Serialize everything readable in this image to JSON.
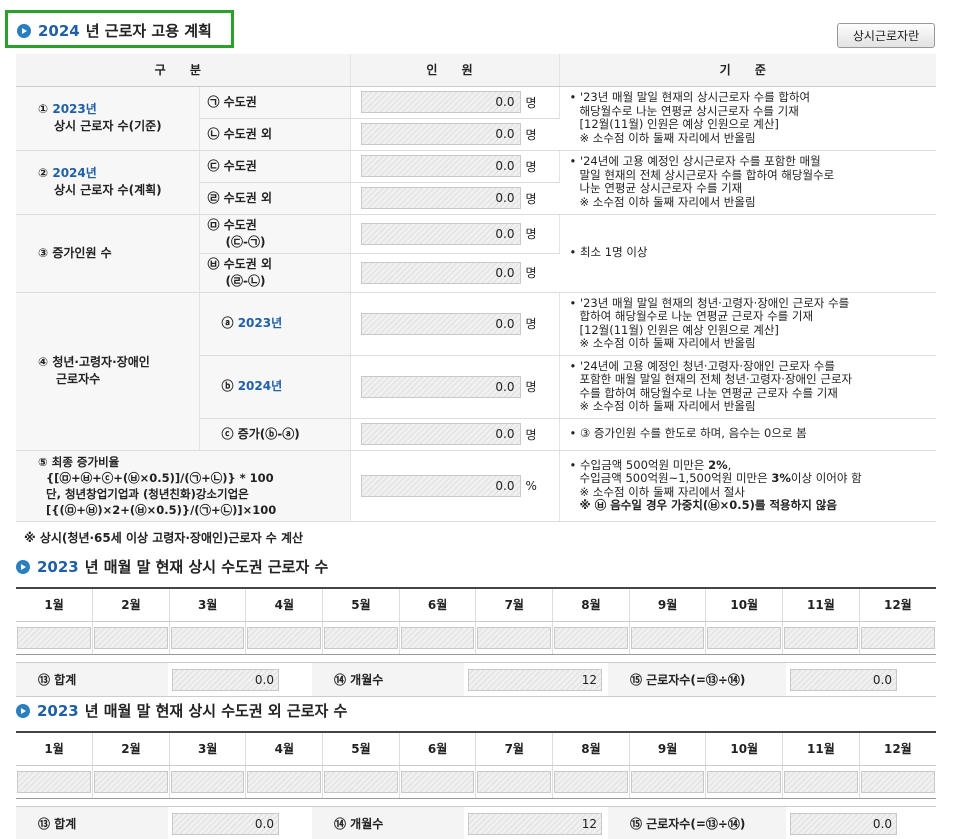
{
  "header": {
    "year": "2024",
    "title_rest": "년 근로자 고용 계획",
    "button": "상시근로자란"
  },
  "table": {
    "headers": [
      "구  분",
      "인  원",
      "기  준"
    ],
    "unit_person": "명",
    "unit_percent": "%",
    "rows": {
      "r1": {
        "cat_num": "①",
        "cat_year": "2023년",
        "cat_text": "상시 근로자 수(기준)",
        "subs": [
          {
            "label": "㉠ 수도권",
            "value": "0.0"
          },
          {
            "label": "㉡ 수도권 외",
            "value": "0.0"
          }
        ],
        "criteria": [
          "• '23년 매월 말일 현재의 상시근로자 수를 합하여",
          "해당월수로 나눈 연평균 상시근로자 수를 기재",
          "[12월(11월) 인원은 예상 인원으로 계산]",
          "※ 소수점 이하 둘째 자리에서 반올림"
        ]
      },
      "r2": {
        "cat_num": "②",
        "cat_year": "2024년",
        "cat_text": "상시 근로자 수(계획)",
        "subs": [
          {
            "label": "㉢ 수도권",
            "value": "0.0"
          },
          {
            "label": "㉣ 수도권 외",
            "value": "0.0"
          }
        ],
        "criteria": [
          "• '24년에 고용 예정인 상시근로자 수를 포함한 매월",
          "말일 현재의 전체 상시근로자 수를 합하여 해당월수로",
          "나눈 연평균 상시근로자 수를 기재",
          "※ 소수점 이하 둘째 자리에서 반올림"
        ]
      },
      "r3": {
        "cat_text": "③ 증가인원 수",
        "subs": [
          {
            "label": "㉤ 수도권",
            "label2": "(㉢-㉠)",
            "value": "0.0"
          },
          {
            "label": "㉥ 수도권 외",
            "label2": "(㉣-㉡)",
            "value": "0.0"
          }
        ],
        "criteria": "• 최소 1명 이상"
      },
      "r4": {
        "cat_line1": "④ 청년·고령자·장애인",
        "cat_line2": "근로자수",
        "subs": [
          {
            "label_prefix": "ⓐ",
            "label_year": "2023년",
            "value": "0.0",
            "criteria": [
              "• '23년 매월 말일 현재의 청년·고령자·장애인 근로자 수를",
              "합하여 해당월수로 나눈 연평균 근로자 수를 기재",
              "[12월(11월) 인원은 예상 인원으로 계산]",
              "※ 소수점 이하 둘째 자리에서 반올림"
            ]
          },
          {
            "label_prefix": "ⓑ",
            "label_year": "2024년",
            "value": "0.0",
            "criteria": [
              "• '24년에 고용 예정인 청년·고령자·장애인 근로자 수를",
              "포함한 매월 말일 현재의 전체 청년·고령자·장애인 근로자",
              "수를 합하여 해당월수로 나눈 연평균 근로자 수를 기재",
              "※ 소수점 이하 둘째 자리에서 반올림"
            ]
          },
          {
            "label": "ⓒ 증가(ⓑ-ⓐ)",
            "value": "0.0",
            "criteria": [
              "• ③ 증가인원 수를 한도로 하며, 음수는 0으로 봄"
            ]
          }
        ]
      },
      "r5": {
        "lines": [
          "⑤ 최종 증가비율",
          "{[㉤+㉥+ⓒ+(㉥×0.5)]/(㉠+㉡)} * 100",
          "단, 청년창업기업과 (청년친화)강소기업은",
          "[{(㉤+㉥)×2+(㉥×0.5)}/(㉠+㉡)]×100"
        ],
        "value": "0.0",
        "criteria_1a": "• 수입금액 500억원 미만은 ",
        "criteria_1b": "2%",
        "criteria_1c": ",",
        "criteria_2a": "수입금액 500억원~1,500억원 미만은 ",
        "criteria_2b": "3%",
        "criteria_2c": "이상 이어야 함",
        "criteria_3": "※ 소수점 이하 둘째 자리에서 절사",
        "criteria_4": "※ ㉥ 음수일 경우 가중치(㉥×0.5)를 적용하지 않음"
      }
    }
  },
  "footnote": "※ 상시(청년·65세 이상 고령자·장애인)근로자 수 계산",
  "sections": [
    {
      "year": "2023",
      "title_rest": "년 매월 말 현재 상시 수도권 근로자 수",
      "months": [
        "1월",
        "2월",
        "3월",
        "4월",
        "5월",
        "6월",
        "7월",
        "8월",
        "9월",
        "10월",
        "11월",
        "12월"
      ],
      "sum_label": "⑬ 합계",
      "sum_value": "0.0",
      "months_label": "⑭ 개월수",
      "months_value": "12",
      "workers_label": "⑮ 근로자수(=⑬÷⑭)",
      "workers_value": "0.0"
    },
    {
      "year": "2023",
      "title_rest": "년 매월 말 현재 상시 수도권 외 근로자 수",
      "months": [
        "1월",
        "2월",
        "3월",
        "4월",
        "5월",
        "6월",
        "7월",
        "8월",
        "9월",
        "10월",
        "11월",
        "12월"
      ],
      "sum_label": "⑬ 합계",
      "sum_value": "0.0",
      "months_label": "⑭ 개월수",
      "months_value": "12",
      "workers_label": "⑮ 근로자수(=⑬÷⑭)",
      "workers_value": "0.0"
    }
  ]
}
